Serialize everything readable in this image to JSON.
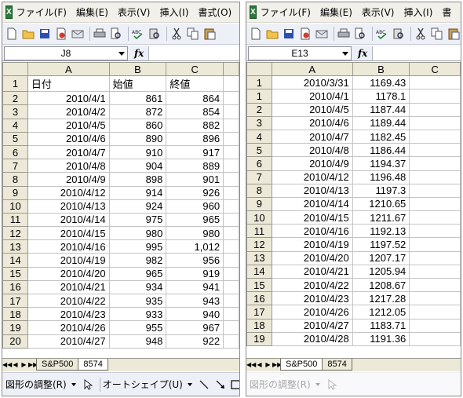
{
  "left": {
    "menu": [
      "ファイル(F)",
      "編集(E)",
      "表示(V)",
      "挿入(I)",
      "書式(O)"
    ],
    "namebox": "J8",
    "columns": [
      "A",
      "B",
      "C"
    ],
    "rows": [
      {
        "n": "1",
        "a": "日付",
        "b": "始値",
        "c": "終値"
      },
      {
        "n": "2",
        "a": "2010/4/1",
        "b": "861",
        "c": "864"
      },
      {
        "n": "3",
        "a": "2010/4/2",
        "b": "872",
        "c": "854"
      },
      {
        "n": "4",
        "a": "2010/4/5",
        "b": "860",
        "c": "882"
      },
      {
        "n": "5",
        "a": "2010/4/6",
        "b": "890",
        "c": "896"
      },
      {
        "n": "6",
        "a": "2010/4/7",
        "b": "910",
        "c": "917"
      },
      {
        "n": "7",
        "a": "2010/4/8",
        "b": "904",
        "c": "889"
      },
      {
        "n": "8",
        "a": "2010/4/9",
        "b": "898",
        "c": "901"
      },
      {
        "n": "9",
        "a": "2010/4/12",
        "b": "914",
        "c": "926"
      },
      {
        "n": "10",
        "a": "2010/4/13",
        "b": "924",
        "c": "960"
      },
      {
        "n": "11",
        "a": "2010/4/14",
        "b": "975",
        "c": "965"
      },
      {
        "n": "12",
        "a": "2010/4/15",
        "b": "980",
        "c": "980"
      },
      {
        "n": "13",
        "a": "2010/4/16",
        "b": "995",
        "c": "1,012"
      },
      {
        "n": "14",
        "a": "2010/4/19",
        "b": "982",
        "c": "956"
      },
      {
        "n": "15",
        "a": "2010/4/20",
        "b": "965",
        "c": "919"
      },
      {
        "n": "16",
        "a": "2010/4/21",
        "b": "934",
        "c": "941"
      },
      {
        "n": "17",
        "a": "2010/4/22",
        "b": "935",
        "c": "943"
      },
      {
        "n": "18",
        "a": "2010/4/23",
        "b": "933",
        "c": "940"
      },
      {
        "n": "19",
        "a": "2010/4/26",
        "b": "955",
        "c": "967"
      },
      {
        "n": "20",
        "a": "2010/4/27",
        "b": "948",
        "c": "922"
      }
    ],
    "tabs": [
      "S&P500",
      "8574"
    ],
    "active_tab": 1,
    "draw_label": "図形の調整(R)",
    "autoshape_label": "オートシェイプ(U)"
  },
  "right": {
    "menu": [
      "ファイル(F)",
      "編集(E)",
      "表示(V)",
      "挿入(I)",
      "書"
    ],
    "namebox": "E13",
    "columns": [
      "A",
      "B",
      "C"
    ],
    "rows": [
      {
        "n": "1",
        "a": "2010/3/31",
        "b": "1169.43",
        "c": ""
      },
      {
        "n": "1",
        "a": "2010/4/1",
        "b": "1178.1",
        "c": ""
      },
      {
        "n": "2",
        "a": "2010/4/5",
        "b": "1187.44",
        "c": ""
      },
      {
        "n": "3",
        "a": "2010/4/6",
        "b": "1189.44",
        "c": ""
      },
      {
        "n": "4",
        "a": "2010/4/7",
        "b": "1182.45",
        "c": ""
      },
      {
        "n": "5",
        "a": "2010/4/8",
        "b": "1186.44",
        "c": ""
      },
      {
        "n": "6",
        "a": "2010/4/9",
        "b": "1194.37",
        "c": ""
      },
      {
        "n": "7",
        "a": "2010/4/12",
        "b": "1196.48",
        "c": ""
      },
      {
        "n": "8",
        "a": "2010/4/13",
        "b": "1197.3",
        "c": ""
      },
      {
        "n": "9",
        "a": "2010/4/14",
        "b": "1210.65",
        "c": ""
      },
      {
        "n": "10",
        "a": "2010/4/15",
        "b": "1211.67",
        "c": ""
      },
      {
        "n": "11",
        "a": "2010/4/16",
        "b": "1192.13",
        "c": ""
      },
      {
        "n": "12",
        "a": "2010/4/19",
        "b": "1197.52",
        "c": ""
      },
      {
        "n": "13",
        "a": "2010/4/20",
        "b": "1207.17",
        "c": ""
      },
      {
        "n": "14",
        "a": "2010/4/21",
        "b": "1205.94",
        "c": ""
      },
      {
        "n": "15",
        "a": "2010/4/22",
        "b": "1208.67",
        "c": ""
      },
      {
        "n": "16",
        "a": "2010/4/23",
        "b": "1217.28",
        "c": ""
      },
      {
        "n": "17",
        "a": "2010/4/26",
        "b": "1212.05",
        "c": ""
      },
      {
        "n": "18",
        "a": "2010/4/27",
        "b": "1183.71",
        "c": ""
      },
      {
        "n": "19",
        "a": "2010/4/28",
        "b": "1191.36",
        "c": ""
      }
    ],
    "tabs": [
      "S&P500",
      "8574"
    ],
    "active_tab": 0,
    "draw_label": "図形の調整(R)"
  }
}
